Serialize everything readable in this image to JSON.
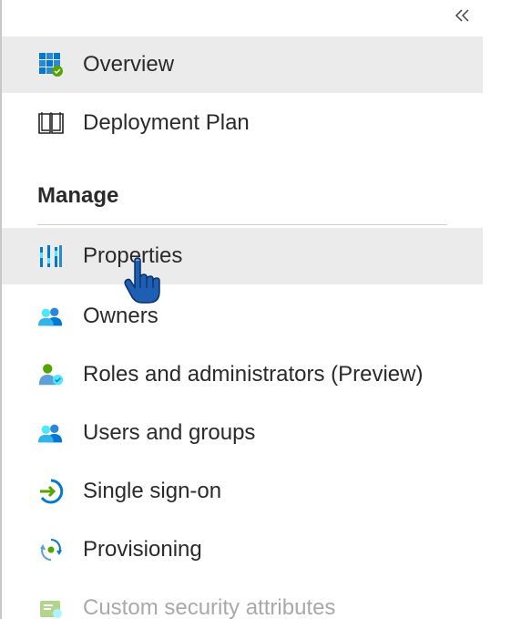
{
  "collapse_button": {
    "glyph": "«",
    "icon": "double-chevron-left-icon"
  },
  "nav": {
    "items": [
      {
        "key": "overview",
        "label": "Overview",
        "icon": "overview-grid-icon",
        "state": "selected"
      },
      {
        "key": "deployment-plan",
        "label": "Deployment Plan",
        "icon": "book-icon",
        "state": "normal"
      }
    ]
  },
  "manage": {
    "header": "Manage",
    "items": [
      {
        "key": "properties",
        "label": "Properties",
        "icon": "properties-bars-icon",
        "state": "hover"
      },
      {
        "key": "owners",
        "label": "Owners",
        "icon": "owners-people-icon",
        "state": "normal"
      },
      {
        "key": "roles",
        "label": "Roles and administrators (Preview)",
        "icon": "roles-person-icon",
        "state": "normal"
      },
      {
        "key": "users-groups",
        "label": "Users and groups",
        "icon": "users-groups-icon",
        "state": "normal"
      },
      {
        "key": "sso",
        "label": "Single sign-on",
        "icon": "single-sign-on-icon",
        "state": "normal"
      },
      {
        "key": "provisioning",
        "label": "Provisioning",
        "icon": "provisioning-icon",
        "state": "normal"
      },
      {
        "key": "custom-security",
        "label": "Custom security attributes",
        "icon": "custom-security-icon",
        "state": "disabled"
      }
    ]
  },
  "colors": {
    "selected_bg": "#ebebeb",
    "accent_blue": "#0078d4",
    "accent_green": "#57a300",
    "disabled_text": "#a9a9a9"
  }
}
